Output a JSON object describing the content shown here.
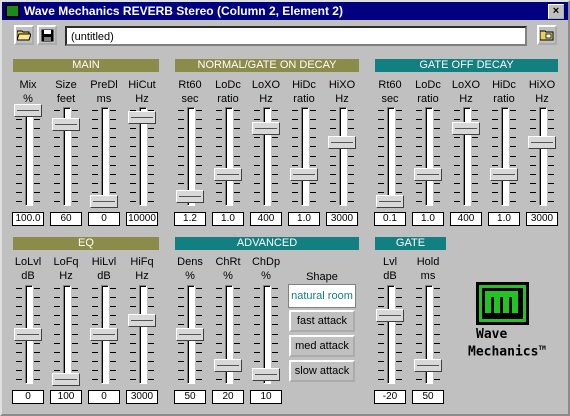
{
  "window": {
    "title": "Wave Mechanics REVERB Stereo (Column 2, Element 2)",
    "close_label": "×"
  },
  "toolbar": {
    "filename": "(untitled)"
  },
  "groups": {
    "main": "MAIN",
    "normal": "NORMAL/GATE ON DECAY",
    "gateoff": "GATE OFF DECAY",
    "eq": "EQ",
    "advanced": "ADVANCED",
    "gate": "GATE"
  },
  "sliders": [
    {
      "id": "mix",
      "label": "Mix\n%",
      "value": "100.0",
      "level": 1.0
    },
    {
      "id": "size",
      "label": "Size\nfeet",
      "value": "60",
      "level": 0.85
    },
    {
      "id": "predl",
      "label": "PreDl\nms",
      "value": "0",
      "level": 0.0
    },
    {
      "id": "hicut",
      "label": "HiCut\nHz",
      "value": "10000",
      "level": 0.92
    },
    {
      "id": "n-rt60",
      "label": "Rt60\nsec",
      "value": "1.2",
      "level": 0.05
    },
    {
      "id": "n-lodc",
      "label": "LoDc\nratio",
      "value": "1.0",
      "level": 0.3
    },
    {
      "id": "n-loxo",
      "label": "LoXO\nHz",
      "value": "400",
      "level": 0.8
    },
    {
      "id": "n-hidc",
      "label": "HiDc\nratio",
      "value": "1.0",
      "level": 0.3
    },
    {
      "id": "n-hixo",
      "label": "HiXO\nHz",
      "value": "3000",
      "level": 0.65
    },
    {
      "id": "g-rt60",
      "label": "Rt60\nsec",
      "value": "0.1",
      "level": 0.0
    },
    {
      "id": "g-lodc",
      "label": "LoDc\nratio",
      "value": "1.0",
      "level": 0.3
    },
    {
      "id": "g-loxo",
      "label": "LoXO\nHz",
      "value": "400",
      "level": 0.8
    },
    {
      "id": "g-hidc",
      "label": "HiDc\nratio",
      "value": "1.0",
      "level": 0.3
    },
    {
      "id": "g-hixo",
      "label": "HiXO\nHz",
      "value": "3000",
      "level": 0.65
    },
    {
      "id": "lolvl",
      "label": "LoLvl\ndB",
      "value": "0",
      "level": 0.5
    },
    {
      "id": "lofq",
      "label": "LoFq\nHz",
      "value": "100",
      "level": 0.0
    },
    {
      "id": "hilvl",
      "label": "HiLvl\ndB",
      "value": "0",
      "level": 0.5
    },
    {
      "id": "hifq",
      "label": "HiFq\nHz",
      "value": "3000",
      "level": 0.65
    },
    {
      "id": "dens",
      "label": "Dens\n%",
      "value": "50",
      "level": 0.5
    },
    {
      "id": "chrt",
      "label": "ChRt\n%",
      "value": "20",
      "level": 0.15
    },
    {
      "id": "chdp",
      "label": "ChDp\n%",
      "value": "10",
      "level": 0.05
    },
    {
      "id": "lvl",
      "label": "Lvl\ndB",
      "value": "-20",
      "level": 0.7
    },
    {
      "id": "hold",
      "label": "Hold\nms",
      "value": "50",
      "level": 0.15
    }
  ],
  "shape": {
    "label": "Shape",
    "options": [
      "natural room",
      "fast attack",
      "med attack",
      "slow attack"
    ],
    "selected": "natural room"
  },
  "logo": {
    "mark": "WM",
    "line1": "Wave",
    "line2": "Mechanics",
    "tm": "TM"
  },
  "colors": {
    "title_bar": "#000080",
    "olive_header": "#8c8c4a",
    "teal_header": "#128080",
    "logo_green": "#22c422"
  }
}
